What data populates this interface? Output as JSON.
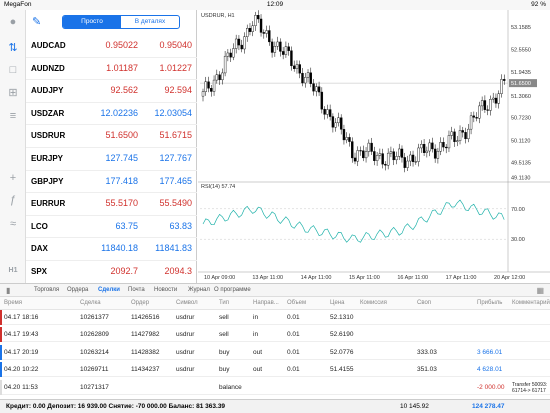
{
  "status_bar": {
    "carrier": "MegaFon",
    "time": "12:09",
    "battery": "92 %"
  },
  "sidebar": {
    "icons": [
      "user-icon",
      "transfer-icon",
      "chat-icon",
      "add-doc-icon",
      "list-icon",
      "crosshair-icon",
      "function-icon",
      "indicator-icon",
      "timeframe-icon"
    ],
    "timeframe_label": "H1"
  },
  "quotes_header": {
    "segment_simple": "Просто",
    "segment_detail": "В деталях"
  },
  "quotes": [
    {
      "symbol": "AUDCAD",
      "bid": "0.95022",
      "ask": "0.95040",
      "bid_color": "red",
      "ask_color": "red"
    },
    {
      "symbol": "AUDNZD",
      "bid": "1.01187",
      "ask": "1.01227",
      "bid_color": "red",
      "ask_color": "red"
    },
    {
      "symbol": "AUDJPY",
      "bid": "92.562",
      "ask": "92.594",
      "bid_color": "red",
      "ask_color": "red"
    },
    {
      "symbol": "USDZAR",
      "bid": "12.02236",
      "ask": "12.03054",
      "bid_color": "blue",
      "ask_color": "blue"
    },
    {
      "symbol": "USDRUR",
      "bid": "51.6500",
      "ask": "51.6715",
      "bid_color": "red",
      "ask_color": "red"
    },
    {
      "symbol": "EURJPY",
      "bid": "127.745",
      "ask": "127.767",
      "bid_color": "blue",
      "ask_color": "blue"
    },
    {
      "symbol": "GBPJPY",
      "bid": "177.418",
      "ask": "177.465",
      "bid_color": "blue",
      "ask_color": "blue"
    },
    {
      "symbol": "EURRUR",
      "bid": "55.5170",
      "ask": "55.5490",
      "bid_color": "red",
      "ask_color": "red"
    },
    {
      "symbol": "LCO",
      "bid": "63.75",
      "ask": "63.83",
      "bid_color": "blue",
      "ask_color": "blue"
    },
    {
      "symbol": "DAX",
      "bid": "11840.18",
      "ask": "11841.83",
      "bid_color": "blue",
      "ask_color": "blue"
    },
    {
      "symbol": "SPX",
      "bid": "2092.7",
      "ask": "2094.3",
      "bid_color": "red",
      "ask_color": "red"
    }
  ],
  "chart": {
    "title": "USDRUR, H1",
    "rsi_label": "RSI(14) 57.74",
    "price_ticks": [
      "53.1585",
      "52.5550",
      "51.9435",
      "51.6500",
      "51.3060",
      "50.7230",
      "50.1120",
      "49.5135",
      "49.1130"
    ],
    "rsi_ticks": [
      "70.00",
      "30.00"
    ],
    "date_ticks": [
      "10 Apr 09:00",
      "13 Apr 11:00",
      "14 Apr 11:00",
      "15 Apr 11:00",
      "16 Apr 11:00",
      "17 Apr 11:00",
      "20 Apr 12:00"
    ],
    "current_price": "51.6500"
  },
  "chart_data": {
    "type": "line",
    "title": "USDRUR, H1",
    "xlabel": "",
    "ylabel": "",
    "x": [
      "10 Apr 09:00",
      "13 Apr 11:00",
      "14 Apr 11:00",
      "15 Apr 11:00",
      "16 Apr 11:00",
      "17 Apr 11:00",
      "20 Apr 12:00"
    ],
    "series": [
      {
        "name": "",
        "values": [
          51.3,
          53.3,
          51.9,
          49.8,
          49.6,
          50.1,
          51.6
        ]
      },
      {
        "name": "RSI(14)",
        "values": [
          50,
          70,
          45,
          30,
          42,
          78,
          57.74
        ]
      }
    ],
    "ylim": [
      49.1,
      53.4
    ]
  },
  "bottom_tabs": [
    "Торговля",
    "Ордера",
    "Сделки",
    "Почта",
    "Новости",
    "Журнал",
    "О программе"
  ],
  "active_tab": "Сделки",
  "deals_columns": [
    "Время",
    "Сделка",
    "Ордер",
    "Символ",
    "Тип",
    "Направ...",
    "Объем",
    "Цена",
    "Комиссия",
    "Своп",
    "Прибыль",
    "Комментарий"
  ],
  "deals": [
    {
      "time": "04.17 18:16",
      "deal": "10261377",
      "order": "11426516",
      "symbol": "usdrur",
      "type": "sell",
      "dir": "in",
      "volume": "0.01",
      "price": "52.1310",
      "commission": "",
      "swap": "",
      "profit": "",
      "comment": "",
      "mark": "#d0312d"
    },
    {
      "time": "04.17 19:43",
      "deal": "10262809",
      "order": "11427982",
      "symbol": "usdrur",
      "type": "sell",
      "dir": "in",
      "volume": "0.01",
      "price": "52.6190",
      "commission": "",
      "swap": "",
      "profit": "",
      "comment": "",
      "mark": "#d0312d"
    },
    {
      "time": "04.17 20:19",
      "deal": "10263214",
      "order": "11428382",
      "symbol": "usdrur",
      "type": "buy",
      "dir": "out",
      "volume": "0.01",
      "price": "52.0776",
      "commission": "",
      "swap": "333.03",
      "profit": "3 666.01",
      "comment": "",
      "mark": "#1a73e8"
    },
    {
      "time": "04.20 10:22",
      "deal": "10269711",
      "order": "11434237",
      "symbol": "usdrur",
      "type": "buy",
      "dir": "out",
      "volume": "0.01",
      "price": "51.4155",
      "commission": "",
      "swap": "351.03",
      "profit": "4 628.01",
      "comment": "",
      "mark": "#1a73e8"
    },
    {
      "time": "04.20 11:53",
      "deal": "10271317",
      "order": "",
      "symbol": "",
      "type": "balance",
      "dir": "",
      "volume": "",
      "price": "",
      "commission": "",
      "swap": "",
      "profit": "-2 000.00",
      "comment": "Transfer 50093: 61714-> 61717",
      "mark": "#dddddd"
    }
  ],
  "footer": {
    "balance_line": "Кредит: 0.00 Депозит: 16 939.00 Снятие: -70 000.00 Баланс: 81 363.39",
    "swap_total": "10 145.92",
    "profit_total": "124 278.47"
  }
}
